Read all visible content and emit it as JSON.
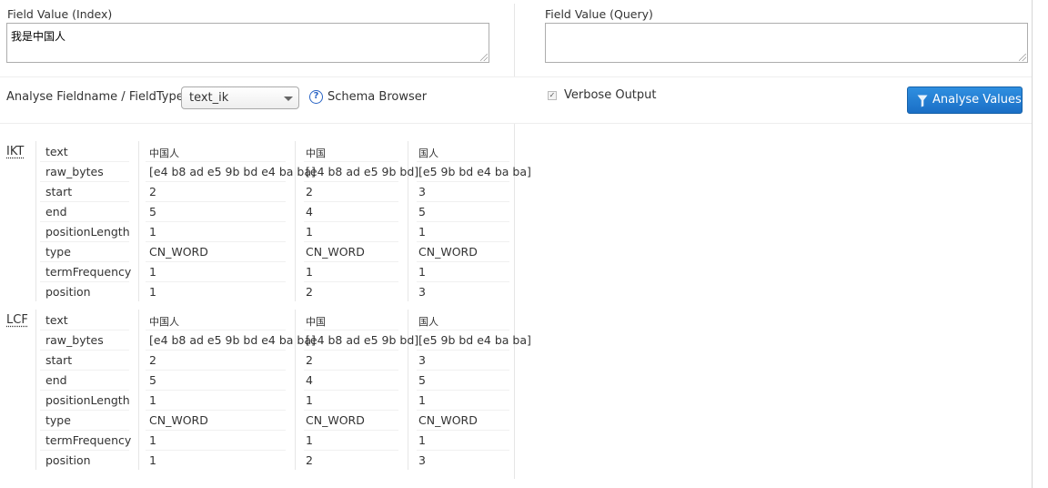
{
  "index_field": {
    "label": "Field Value (Index)",
    "value": "我是中国人"
  },
  "query_field": {
    "label": "Field Value (Query)",
    "value": ""
  },
  "fieldname": {
    "label": "Analyse Fieldname / FieldType:",
    "selected": "text_ik"
  },
  "schema_browser": {
    "icon": "help-circle-icon",
    "label": "Schema Browser"
  },
  "verbose": {
    "label": "Verbose Output",
    "checked": true
  },
  "analyse_button": {
    "label": "Analyse Values",
    "icon": "funnel-icon",
    "color": "#1f78d1"
  },
  "row_labels": [
    "text",
    "raw_bytes",
    "start",
    "end",
    "positionLength",
    "type",
    "termFrequency",
    "position"
  ],
  "analysis": [
    {
      "name": "IKT",
      "tokens": [
        {
          "text": "中国人",
          "raw_bytes": "[e4 b8 ad e5 9b bd e4 ba ba]",
          "start": "2",
          "end": "5",
          "positionLength": "1",
          "type": "CN_WORD",
          "termFrequency": "1",
          "position": "1"
        },
        {
          "text": "中国",
          "raw_bytes": "[e4 b8 ad e5 9b bd]",
          "start": "2",
          "end": "4",
          "positionLength": "1",
          "type": "CN_WORD",
          "termFrequency": "1",
          "position": "2"
        },
        {
          "text": "国人",
          "raw_bytes": "[e5 9b bd e4 ba ba]",
          "start": "3",
          "end": "5",
          "positionLength": "1",
          "type": "CN_WORD",
          "termFrequency": "1",
          "position": "3"
        }
      ]
    },
    {
      "name": "LCF",
      "tokens": [
        {
          "text": "中国人",
          "raw_bytes": "[e4 b8 ad e5 9b bd e4 ba ba]",
          "start": "2",
          "end": "5",
          "positionLength": "1",
          "type": "CN_WORD",
          "termFrequency": "1",
          "position": "1"
        },
        {
          "text": "中国",
          "raw_bytes": "[e4 b8 ad e5 9b bd]",
          "start": "2",
          "end": "4",
          "positionLength": "1",
          "type": "CN_WORD",
          "termFrequency": "1",
          "position": "2"
        },
        {
          "text": "国人",
          "raw_bytes": "[e5 9b bd e4 ba ba]",
          "start": "3",
          "end": "5",
          "positionLength": "1",
          "type": "CN_WORD",
          "termFrequency": "1",
          "position": "3"
        }
      ]
    }
  ]
}
